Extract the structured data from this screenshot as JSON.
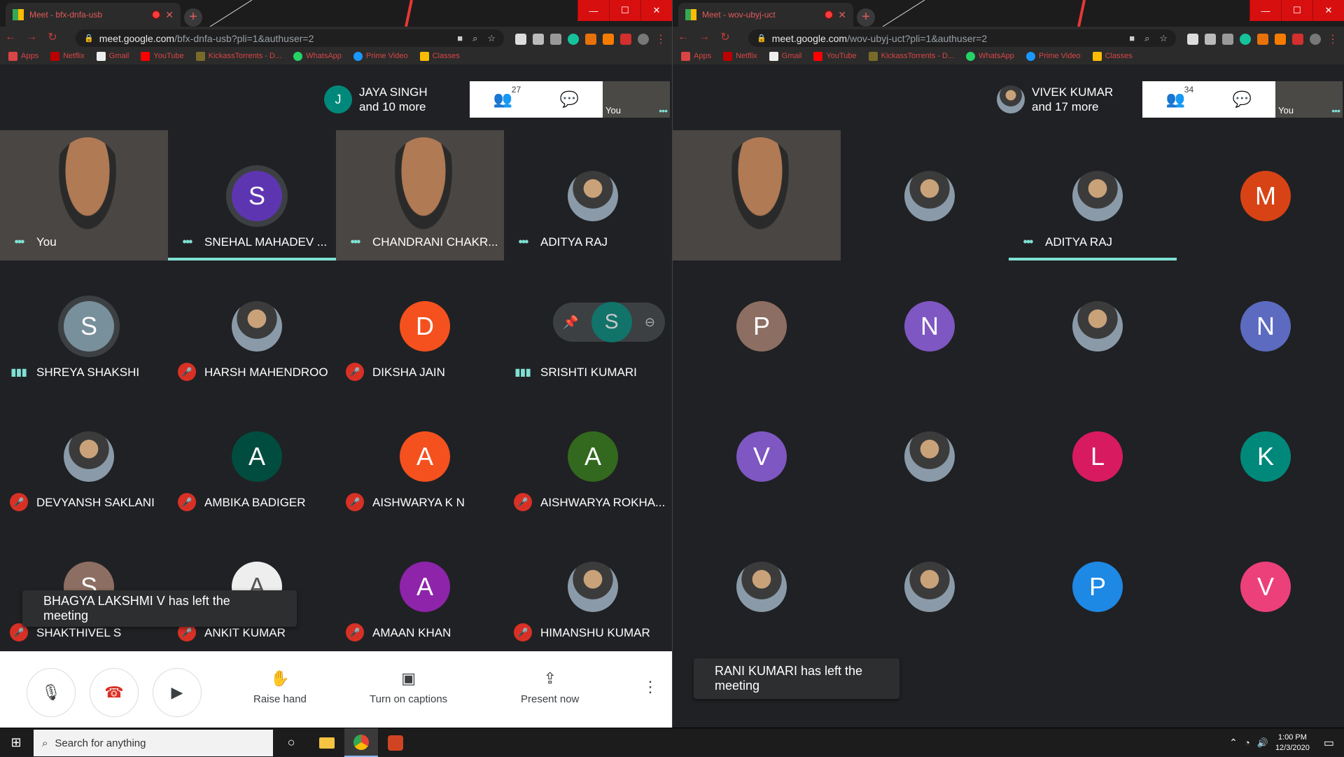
{
  "left": {
    "tab_title": "Meet - bfx-dnfa-usb",
    "url_host": "meet.google.com",
    "url_path": "/bfx-dnfa-usb?pli=1&authuser=2",
    "host_chip": {
      "initial": "J",
      "name": "JAYA SINGH",
      "more": "and 10 more",
      "color": "#00897b"
    },
    "people_count": "27",
    "self_label": "You",
    "tiles": [
      {
        "name": "You",
        "type": "camera",
        "indicator": "dots"
      },
      {
        "name": "SNEHAL MAHADEV ...",
        "type": "initial",
        "initial": "S",
        "color": "#5e35b1",
        "indicator": "dots",
        "speaking": true,
        "ring": true
      },
      {
        "name": "CHANDRANI CHAKR...",
        "type": "camera",
        "indicator": "dots"
      },
      {
        "name": "ADITYA RAJ",
        "type": "photo",
        "indicator": "dots"
      },
      {
        "name": "SHREYA SHAKSHI",
        "type": "initial",
        "initial": "S",
        "color": "#78909c",
        "indicator": "bars",
        "ring": true
      },
      {
        "name": "HARSH MAHENDROO",
        "type": "photo",
        "indicator": "mute"
      },
      {
        "name": "DIKSHA JAIN",
        "type": "initial",
        "initial": "D",
        "color": "#f4511e",
        "indicator": "mute"
      },
      {
        "name": "SRISHTI KUMARI",
        "type": "hover",
        "initial": "S",
        "color": "#00897b",
        "indicator": "bars"
      },
      {
        "name": "DEVYANSH SAKLANI",
        "type": "photo",
        "indicator": "mute"
      },
      {
        "name": "AMBIKA BADIGER",
        "type": "initial",
        "initial": "A",
        "color": "#004d40",
        "indicator": "mute"
      },
      {
        "name": "AISHWARYA K N",
        "type": "initial",
        "initial": "A",
        "color": "#f4511e",
        "indicator": "mute"
      },
      {
        "name": "AISHWARYA ROKHA...",
        "type": "initial",
        "initial": "A",
        "color": "#33691e",
        "indicator": "mute"
      },
      {
        "name": "SHAKTHIVEL S",
        "type": "initial",
        "initial": "S",
        "color": "#8d6e63",
        "indicator": "mute"
      },
      {
        "name": "ANKIT KUMAR",
        "type": "initial",
        "initial": "A",
        "color": "#eeeeee",
        "indicator": "mute"
      },
      {
        "name": "AMAAN KHAN",
        "type": "initial",
        "initial": "A",
        "color": "#8e24aa",
        "indicator": "mute"
      },
      {
        "name": "HIMANSHU KUMAR",
        "type": "photo",
        "indicator": "mute"
      }
    ],
    "toast": "BHAGYA LAKSHMI V has left the meeting",
    "controls": {
      "raise_hand": "Raise hand",
      "captions": "Turn on captions",
      "present": "Present now"
    }
  },
  "right": {
    "tab_title": "Meet - wov-ubyj-uct",
    "url_host": "meet.google.com",
    "url_path": "/wov-ubyj-uct?pli=1&authuser=2",
    "host_chip": {
      "name": "VIVEK KUMAR",
      "more": "and 17 more"
    },
    "people_count": "34",
    "self_label": "You",
    "tiles": [
      {
        "name": "",
        "type": "camera"
      },
      {
        "name": "",
        "type": "photo"
      },
      {
        "name": "ADITYA RAJ",
        "type": "photo",
        "indicator": "dots",
        "speaking": true
      },
      {
        "name": "",
        "type": "initial",
        "initial": "M",
        "color": "#d84315"
      },
      {
        "name": "",
        "type": "initial",
        "initial": "P",
        "color": "#8d6e63"
      },
      {
        "name": "",
        "type": "initial",
        "initial": "N",
        "color": "#7e57c2"
      },
      {
        "name": "",
        "type": "photo"
      },
      {
        "name": "",
        "type": "initial",
        "initial": "N",
        "color": "#5c6bc0"
      },
      {
        "name": "",
        "type": "initial",
        "initial": "V",
        "color": "#7e57c2"
      },
      {
        "name": "",
        "type": "photo"
      },
      {
        "name": "",
        "type": "initial",
        "initial": "L",
        "color": "#d81b60"
      },
      {
        "name": "",
        "type": "initial",
        "initial": "K",
        "color": "#00897b"
      },
      {
        "name": "",
        "type": "photo"
      },
      {
        "name": "",
        "type": "photo"
      },
      {
        "name": "",
        "type": "initial",
        "initial": "P",
        "color": "#1e88e5"
      },
      {
        "name": "",
        "type": "initial",
        "initial": "V",
        "color": "#ec407a"
      }
    ],
    "toast": "RANI KUMARI has left the meeting"
  },
  "bookmarks": [
    "Apps",
    "Netflix",
    "Gmail",
    "YouTube",
    "KickassTorrents - D...",
    "WhatsApp",
    "Prime Video",
    "Classes"
  ],
  "taskbar": {
    "search_placeholder": "Search for anything",
    "time": "1:00 PM",
    "date": "12/3/2020"
  },
  "colors": {
    "accent": "#7fe0d4",
    "mute": "#d93025",
    "window_red": "#d80f0f"
  }
}
